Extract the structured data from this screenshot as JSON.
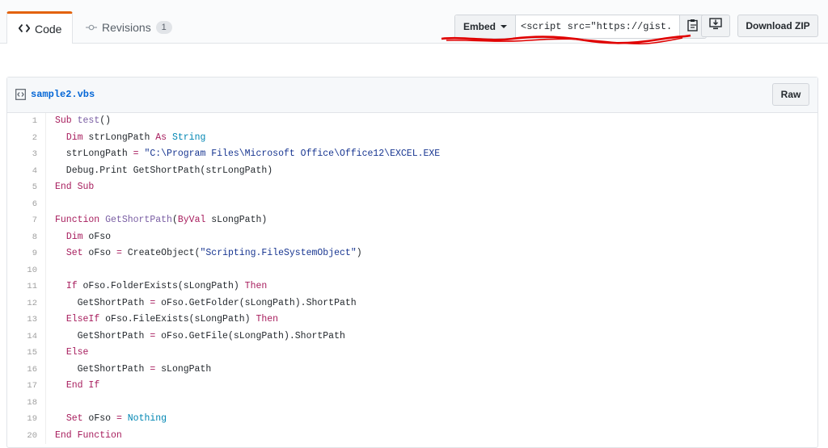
{
  "tabs": {
    "code": {
      "label": "Code",
      "icon": "code-icon"
    },
    "revisions": {
      "label": "Revisions",
      "icon": "commit-icon",
      "count": "1"
    }
  },
  "toolbar": {
    "embed_label": "Embed",
    "embed_value": "<script src=\"https://gist.",
    "copy_icon": "clipboard-icon",
    "desktop_icon": "download-desktop-icon",
    "download_zip_label": "Download ZIP"
  },
  "file": {
    "name": "sample2.vbs",
    "raw_label": "Raw",
    "icon": "file-code-icon"
  },
  "colors": {
    "keyword": "#a71d5d",
    "function": "#795da3",
    "type": "#0086b3",
    "string": "#183691",
    "link": "#0366d6",
    "active_tab_accent": "#e36209",
    "annotation": "#e00000"
  },
  "code": {
    "lines": [
      {
        "n": "1",
        "segs": [
          [
            "kw",
            "Sub"
          ],
          [
            "t",
            " "
          ],
          [
            "fn",
            "test"
          ],
          [
            "t",
            "()"
          ]
        ]
      },
      {
        "n": "2",
        "segs": [
          [
            "t",
            "  "
          ],
          [
            "kw",
            "Dim"
          ],
          [
            "t",
            " strLongPath "
          ],
          [
            "kw",
            "As"
          ],
          [
            "t",
            " "
          ],
          [
            "tp",
            "String"
          ]
        ]
      },
      {
        "n": "3",
        "segs": [
          [
            "t",
            "  strLongPath "
          ],
          [
            "kw",
            "="
          ],
          [
            "t",
            " "
          ],
          [
            "st",
            "\"C:\\Program Files\\Microsoft Office\\Office12\\EXCEL.EXE"
          ]
        ]
      },
      {
        "n": "4",
        "segs": [
          [
            "t",
            "  Debug.Print GetShortPath(strLongPath)"
          ]
        ]
      },
      {
        "n": "5",
        "segs": [
          [
            "kw",
            "End Sub"
          ]
        ]
      },
      {
        "n": "6",
        "segs": []
      },
      {
        "n": "7",
        "segs": [
          [
            "kw",
            "Function"
          ],
          [
            "t",
            " "
          ],
          [
            "fn",
            "GetShortPath"
          ],
          [
            "t",
            "("
          ],
          [
            "kw",
            "ByVal"
          ],
          [
            "t",
            " sLongPath)"
          ]
        ]
      },
      {
        "n": "8",
        "segs": [
          [
            "t",
            "  "
          ],
          [
            "kw",
            "Dim"
          ],
          [
            "t",
            " oFso"
          ]
        ]
      },
      {
        "n": "9",
        "segs": [
          [
            "t",
            "  "
          ],
          [
            "kw",
            "Set"
          ],
          [
            "t",
            " oFso "
          ],
          [
            "kw",
            "="
          ],
          [
            "t",
            " CreateObject("
          ],
          [
            "st",
            "\"Scripting.FileSystemObject\""
          ],
          [
            "t",
            ")"
          ]
        ]
      },
      {
        "n": "10",
        "segs": []
      },
      {
        "n": "11",
        "segs": [
          [
            "t",
            "  "
          ],
          [
            "kw",
            "If"
          ],
          [
            "t",
            " oFso.FolderExists(sLongPath) "
          ],
          [
            "kw",
            "Then"
          ]
        ]
      },
      {
        "n": "12",
        "segs": [
          [
            "t",
            "    GetShortPath "
          ],
          [
            "kw",
            "="
          ],
          [
            "t",
            " oFso.GetFolder(sLongPath).ShortPath"
          ]
        ]
      },
      {
        "n": "13",
        "segs": [
          [
            "t",
            "  "
          ],
          [
            "kw",
            "ElseIf"
          ],
          [
            "t",
            " oFso.FileExists(sLongPath) "
          ],
          [
            "kw",
            "Then"
          ]
        ]
      },
      {
        "n": "14",
        "segs": [
          [
            "t",
            "    GetShortPath "
          ],
          [
            "kw",
            "="
          ],
          [
            "t",
            " oFso.GetFile(sLongPath).ShortPath"
          ]
        ]
      },
      {
        "n": "15",
        "segs": [
          [
            "t",
            "  "
          ],
          [
            "kw",
            "Else"
          ]
        ]
      },
      {
        "n": "16",
        "segs": [
          [
            "t",
            "    GetShortPath "
          ],
          [
            "kw",
            "="
          ],
          [
            "t",
            " sLongPath"
          ]
        ]
      },
      {
        "n": "17",
        "segs": [
          [
            "t",
            "  "
          ],
          [
            "kw",
            "End If"
          ]
        ]
      },
      {
        "n": "18",
        "segs": []
      },
      {
        "n": "19",
        "segs": [
          [
            "t",
            "  "
          ],
          [
            "kw",
            "Set"
          ],
          [
            "t",
            " oFso "
          ],
          [
            "kw",
            "="
          ],
          [
            "t",
            " "
          ],
          [
            "tp",
            "Nothing"
          ]
        ]
      },
      {
        "n": "20",
        "segs": [
          [
            "kw",
            "End Function"
          ]
        ]
      }
    ]
  }
}
